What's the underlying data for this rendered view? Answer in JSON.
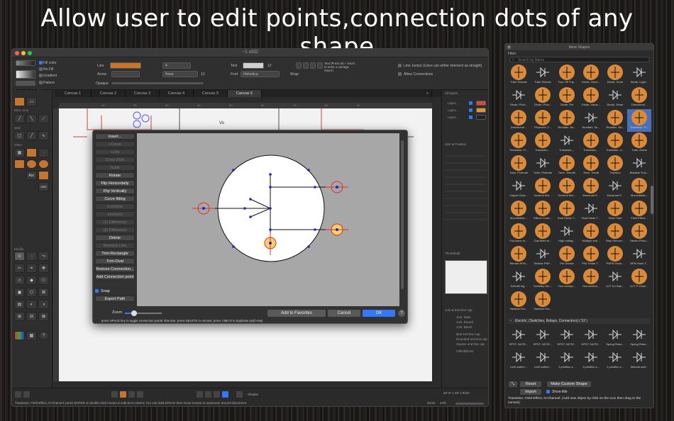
{
  "headline": "Allow user to edit points,connection dots of any shape",
  "window": {
    "title": "~1.old2",
    "traffic_colors": [
      "#ff5f57",
      "#febc2e",
      "#28c840"
    ],
    "accent": "#3478f6"
  },
  "toolbar": {
    "fill_color": "Fill color",
    "no_fill": "No Fill",
    "gradient": "Gradient",
    "pattern": "Pattern",
    "line": "Line",
    "arrow": "Arrow",
    "opaque": "Opaque",
    "line_width": "4",
    "arrow_none": "None",
    "arrow_value": "13",
    "text": "Text",
    "font_size": "12",
    "font": "Font",
    "font_name": "Helvetica",
    "wrap": "Wrap",
    "text_hint": "Text (Press alt + return to enter a carriage return)",
    "line_jumps": "Line Jumps (Lines can either intersect as straight)",
    "allow_connections": "Allow Connections",
    "arrow_labels": [
      "Arrow",
      "Insert",
      "Delete"
    ]
  },
  "tabs": [
    "Canvas 1",
    "Canvas 2",
    "Canvas 3",
    "Canvas 4",
    "Canvas 5",
    "Canvas 6"
  ],
  "tools_sections": [
    "Wire, Line",
    "Wall",
    "Other",
    "Modify"
  ],
  "tool_items": {
    "text_tool": "Abc",
    "abc": "ABC"
  },
  "canvas": {
    "ruler_marks": [
      "10",
      "20",
      "30",
      "40",
      "50",
      "60",
      "70",
      "80",
      "90"
    ],
    "vo_label": "Vo"
  },
  "dialog": {
    "menu": [
      {
        "label": "Insert...",
        "enabled": true
      },
      {
        "label": "+Curve",
        "enabled": false
      },
      {
        "label": "+Line",
        "enabled": false
      },
      {
        "label": "Close Path",
        "enabled": false
      },
      {
        "label": "Scale",
        "enabled": false
      },
      {
        "label": "Rotate",
        "enabled": true
      },
      {
        "label": "Flip Horizontally",
        "enabled": true
      },
      {
        "label": "Flip Vertically",
        "enabled": true
      },
      {
        "label": "Curve fitting",
        "enabled": true
      },
      {
        "label": "Combine",
        "enabled": false
      },
      {
        "label": "Intersect",
        "enabled": false
      },
      {
        "label": "(1) Difference",
        "enabled": false
      },
      {
        "label": "(2) Difference",
        "enabled": false
      },
      {
        "label": "Delete",
        "enabled": true
      },
      {
        "label": "Remove Line",
        "enabled": false
      },
      {
        "label": "Trim-Rectangle",
        "enabled": true
      },
      {
        "label": "Trim-Oval",
        "enabled": true
      },
      {
        "label": "Restore Connection...",
        "enabled": true
      },
      {
        "label": "Add Connection point",
        "enabled": true
      }
    ],
    "snap": "Snap",
    "export_path": "Export Path",
    "zoom": "Zoom",
    "zoom_level": 0.25,
    "add_favorites": "Add to Favorites",
    "cancel": "Cancel",
    "ok": "OK",
    "help": "?",
    "hint": "press SPACE key to toggle connection points' direction; press DELETE to remove; press CMD-D to duplicate (add new)"
  },
  "right_panel": {
    "all_layers": "All layers",
    "layers": [
      "Layer...",
      "Layer...",
      "Layer..."
    ],
    "layer_colors": [
      "#d94a3c",
      "#e0952e",
      "#222222"
    ],
    "size_position": "Size & Position",
    "thumbnail": "Thumbnail",
    "join_end": "Join & End line cap",
    "join_options": [
      "Join: Miter",
      "Join: Round",
      "Join: Bevel"
    ],
    "cap_options": [
      "Butt end line cap",
      "Rounded end line cap",
      "Square end line cap"
    ],
    "fill_odd": "FillOddEven"
  },
  "status": {
    "message": "Transistor, Field-Effect, N-Channel: press ENTER or double-click mouse to edit text content; You can hold SPACE then move mouse to maneuver around document",
    "coords": "58' 8\" x 48' 2 9/16\"",
    "zoom_label": "Zoom",
    "zoom_value": "40%",
    "shades": "Shades"
  },
  "shapes_panel": {
    "title": "More Shapes",
    "filter": "Filter:",
    "search_placeholder": "Search by Name",
    "grid": [
      [
        "Tube Tetrode",
        "Tube Tetrode",
        "Turn Off Thy...",
        "Diode, Gene...",
        "Diode, Gunn",
        "Diode, Light..."
      ],
      [
        "Diode, Phot...",
        "Diode, Phot...",
        "Diode, Pin",
        "Diode, Varac...",
        "Diode, Zener",
        "Directional..."
      ],
      [
        "Directional...",
        "Photocell, T...",
        "Rectifier, Se...",
        "Rectifier, Se...",
        "Rectifier, Sili...",
        "Transistor, Fi..."
      ],
      [
        "Transistor, Fi...",
        "Transistor,...",
        "Transistor,...",
        "Transistor,...",
        "Transistor, U...",
        "Tube, Diode"
      ],
      [
        "Tube, Pentode",
        "Tube, Pentode",
        "Tube, Tetrode",
        "Tube, Triode",
        "Thyristor",
        "Bistable Tran..."
      ],
      [
        "Clipper Diod...",
        "General Mot...",
        "General Mot...",
        "Monaural P...",
        "Monaural P...",
        "Monostable..."
      ],
      [
        "Monostable...",
        "Silicon Contr...",
        "Dual Diode T...",
        "Dual triode T...",
        "Glow Tube",
        "Field Effect..."
      ],
      [
        "Full-wave re...",
        "Gas-filled re...",
        "High-voltag...",
        "Multiple-emi...",
        "Step Recove...",
        "Stereo Picku..."
      ],
      [
        "Tetrode NPN...",
        "Tetrode PNP...",
        "Pin Diodes",
        "PIN Triode T...",
        "PNPN Hook...",
        "NPN Hook T..."
      ],
      [
        "Schmitt trig...",
        "Schottky Dio...",
        "Two-conduc...",
        "Two-section...",
        "UJT N-Chan...",
        "UJT P-Chan..."
      ],
      [
        "Varactor Dio...",
        "Varactor Dio..."
      ]
    ],
    "category": "Electric: (Switches, Relays, Connectors) ( 53 )",
    "grid2": [
      [
        "SPST. NOTE...",
        "SPST. NOTE...",
        "DPST. NOTE...",
        "DPDT. NOTE...",
        "Spring Retur...",
        "Spring Retur..."
      ],
      [
        "Limit switch...",
        "Limit switch...",
        "2 position s...",
        "3 position s...",
        "4 position s...",
        "Manual swit..."
      ]
    ],
    "reset": "Reset",
    "make_custom": "Make Custom Shape",
    "import": "Import",
    "show_title": "Show title",
    "footer": "Transistor, Field-Effect, N-Channel: (Add new object by click on the icon then drag to the canvas)"
  }
}
